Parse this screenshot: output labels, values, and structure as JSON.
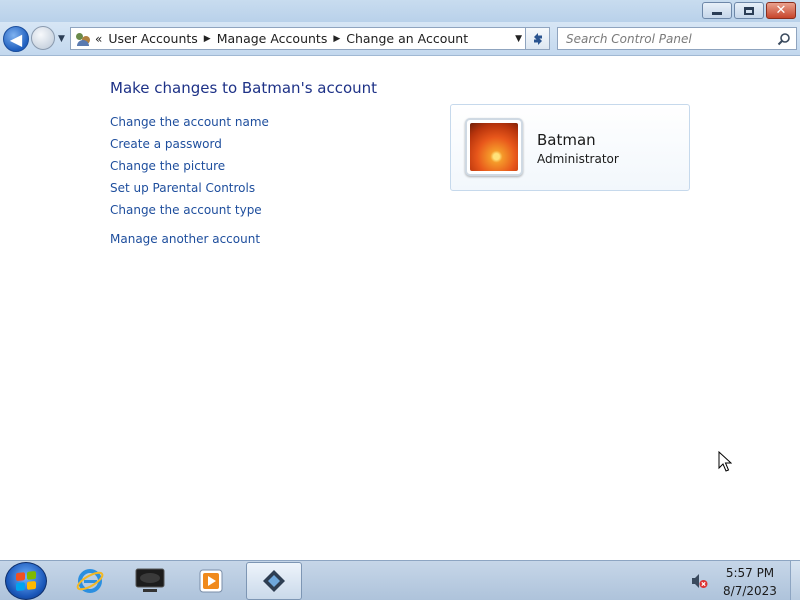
{
  "window": {
    "minimize_icon": "minimize-icon",
    "maximize_icon": "restore-icon",
    "close_glyph": "✕"
  },
  "navigation": {
    "back_glyph": "◀",
    "history_glyph": "▼",
    "breadcrumb_lead": "«",
    "breadcrumb_separator": "▶",
    "breadcrumb": [
      "User Accounts",
      "Manage Accounts",
      "Change an Account"
    ],
    "dropdown_glyph": "▼",
    "refresh_icon": "refresh-icon"
  },
  "search": {
    "placeholder": "Search Control Panel"
  },
  "main": {
    "title": "Make changes to Batman's account",
    "tasks": [
      "Change the account name",
      "Create a password",
      "Change the picture",
      "Set up Parental Controls",
      "Change the account type"
    ],
    "secondary_task": "Manage another account"
  },
  "account": {
    "name": "Batman",
    "type": "Administrator",
    "picture": "orange-flower"
  },
  "taskbar": {
    "pinned": [
      "internet-explorer",
      "network-computer",
      "media-player",
      "active-app"
    ],
    "tray_icon": "volume-muted-icon",
    "time": "5:57 PM",
    "date": "8/7/2023"
  },
  "colors": {
    "link": "#1e4e9d",
    "title": "#1e3287",
    "close_button": "#c7452b"
  }
}
